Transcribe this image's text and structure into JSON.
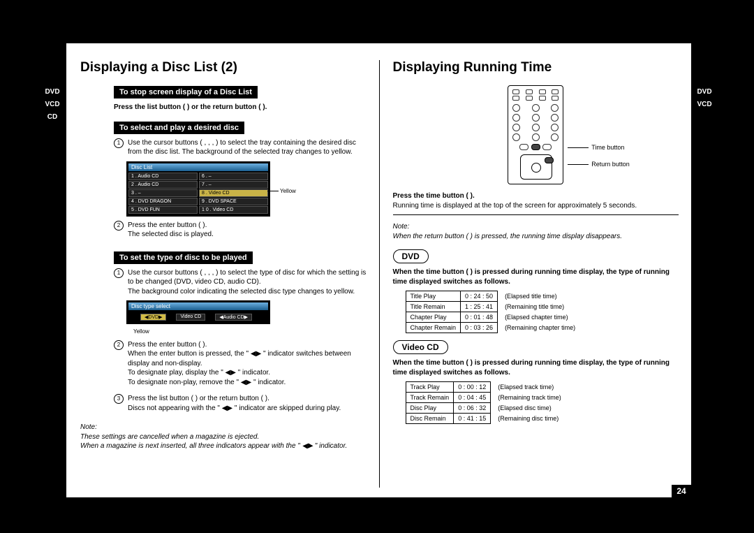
{
  "left": {
    "title": "Displaying a Disc List (2)",
    "badges": [
      "DVD",
      "VCD",
      "CD"
    ],
    "sect1": {
      "head": "To stop screen display of a Disc List",
      "text": "Press the list button (        ) or the return button (        )."
    },
    "sect2": {
      "head": "To select and play a desired disc",
      "step1": "Use the cursor buttons (   ,   ,   ,   ) to select the tray containing the desired disc from the disc list. The background of the selected tray changes to yellow.",
      "osd_title": "Disc List",
      "osd_left": [
        "1 . Audio CD",
        "2 . Audio CD",
        "3 . –",
        "4 . DVD DRAGON",
        "5 . DVD FUN"
      ],
      "osd_right": [
        "6 . –",
        "7 . –",
        "8 . Video  CD",
        "9 . DVD SPACE",
        "1 0 . Video CD"
      ],
      "leader_label": "Yellow",
      "step2a": "Press the enter button (        ).",
      "step2b": "The selected disc is played."
    },
    "sect3": {
      "head": "To set the type of disc to be played",
      "step1a": "Use the cursor buttons (   ,   ,   ,   ) to select the type of disc for which the setting is to be changed (DVD, video CD, audio CD).",
      "step1b": "The background color indicating the selected disc type changes to yellow.",
      "osd_title": "Disc type select",
      "chips": [
        "◀DVD▶",
        "Video CD",
        "◀Audio CD▶"
      ],
      "chip_label": "Yellow",
      "step2a": "Press the enter button (        ).",
      "step2b": "When the enter button is pressed, the \" ◀▶ \" indicator switches between display and non-display.",
      "step2c": "To designate play, display the \" ◀▶ \" indicator.",
      "step2d": "To designate non-play, remove the \" ◀▶ \" indicator.",
      "step3a": "Press the list button (        ) or the return button (        ).",
      "step3b": "Discs not appearing with the \" ◀▶ \" indicator are skipped during play."
    },
    "note_label": "Note:",
    "note1": "These settings are cancelled when a magazine is ejected.",
    "note2": "When a magazine is next inserted, all three indicators appear with the \" ◀▶ \" indicator."
  },
  "right": {
    "title": "Displaying Running Time",
    "badges": [
      "DVD",
      "VCD"
    ],
    "callout_time": "Time button",
    "callout_return": "Return button",
    "press": "Press the time button (        ).",
    "press_sub": "Running time is displayed at the top of the screen for approximately 5 seconds.",
    "note_label": "Note:",
    "note": "When the return button (        ) is pressed, the running time display disappears.",
    "dvd": {
      "pill": "DVD",
      "lead": "When the time button (        ) is pressed during running time display, the type of running time displayed switches as follows.",
      "rows": [
        {
          "a": "Title Play",
          "b": "0 : 24 : 50",
          "c": "(Elapsed title time)"
        },
        {
          "a": "Title Remain",
          "b": "1 : 25 : 41",
          "c": "(Remaining title time)"
        },
        {
          "a": "Chapter Play",
          "b": "0 : 01 : 48",
          "c": "(Elapsed chapter time)"
        },
        {
          "a": "Chapter Remain",
          "b": "0 : 03 : 26",
          "c": "(Remaining chapter time)"
        }
      ]
    },
    "vcd": {
      "pill": "Video CD",
      "lead": "When the time button (        ) is pressed during running time display, the type of running time displayed switches as follows.",
      "rows": [
        {
          "a": "Track Play",
          "b": "0 : 00 : 12",
          "c": "(Elapsed track time)"
        },
        {
          "a": "Track Remain",
          "b": "0 : 04 : 45",
          "c": "(Remaining track time)"
        },
        {
          "a": "Disc Play",
          "b": "0 : 06 : 32",
          "c": "(Elapsed disc time)"
        },
        {
          "a": "Disc Remain",
          "b": "0 : 41 : 15",
          "c": "(Remaining disc time)"
        }
      ]
    }
  },
  "page": "24"
}
